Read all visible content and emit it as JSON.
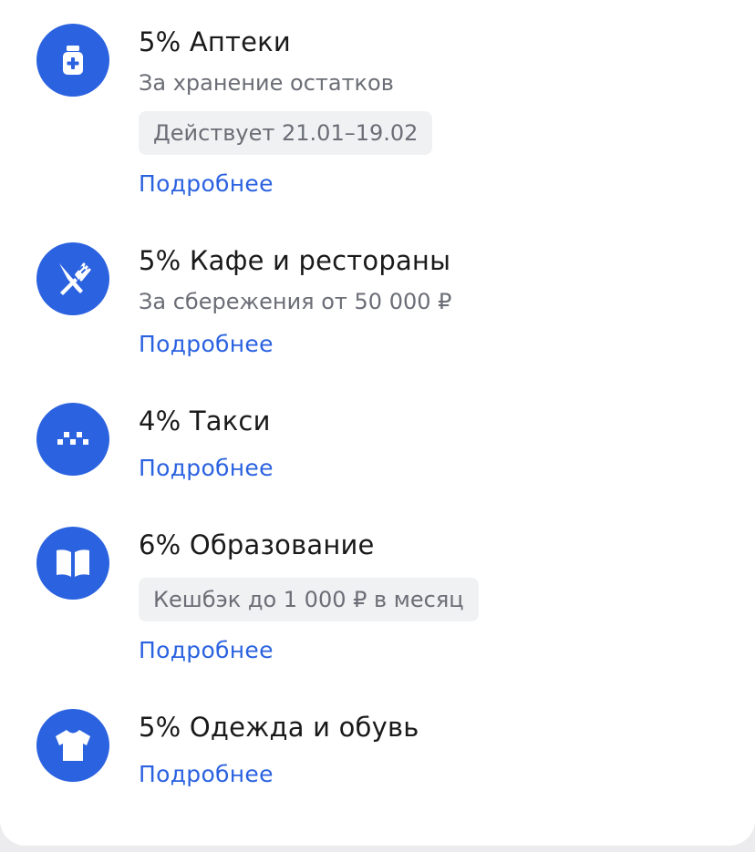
{
  "colors": {
    "accent": "#2b62e0",
    "title": "#1a1a1a",
    "secondary": "#6b6e76",
    "badge_bg": "#f0f1f3"
  },
  "items": [
    {
      "icon": "pharmacy-icon",
      "title": "5% Аптеки",
      "subtitle": "За хранение остатков",
      "badge": "Действует 21.01–19.02",
      "link": "Подробнее"
    },
    {
      "icon": "fork-knife-icon",
      "title": "5% Кафе и рестораны",
      "subtitle": "За сбережения от 50 000 ₽",
      "link": "Подробнее"
    },
    {
      "icon": "taxi-icon",
      "title": "4% Такси",
      "link": "Подробнее"
    },
    {
      "icon": "book-icon",
      "title": "6% Образование",
      "badge": "Кешбэк до 1 000 ₽ в месяц",
      "link": "Подробнее"
    },
    {
      "icon": "tshirt-icon",
      "title": "5% Одежда и обувь",
      "link": "Подробнее"
    }
  ]
}
